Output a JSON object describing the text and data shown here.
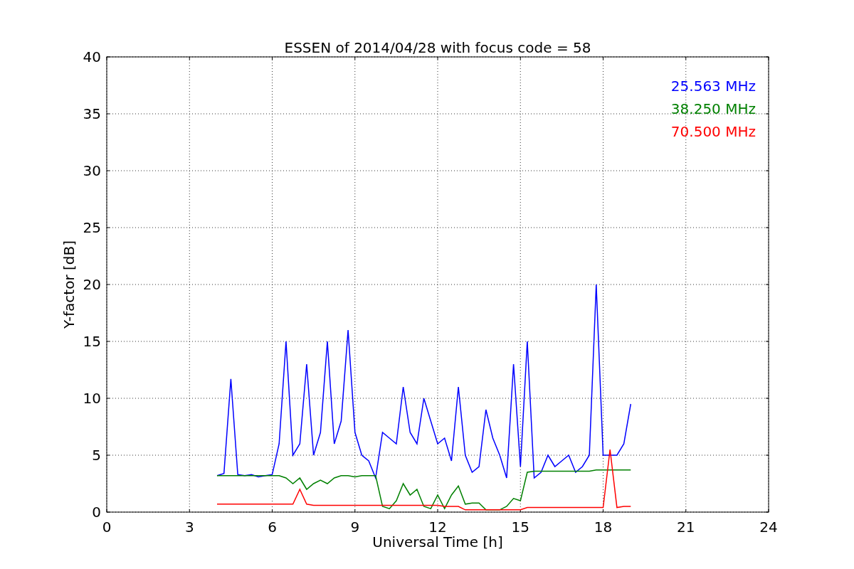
{
  "figure": {
    "chart_data": {
      "type": "line",
      "title": "ESSEN of 2014/04/28 with focus code = 58",
      "xlabel": "Universal Time [h]",
      "ylabel": "Y-factor [dB]",
      "grid": true,
      "xlim": [
        0,
        24
      ],
      "ylim": [
        0,
        40
      ],
      "xticks": [
        0,
        3,
        6,
        9,
        12,
        15,
        18,
        21,
        24
      ],
      "yticks": [
        0,
        5,
        10,
        15,
        20,
        25,
        30,
        35,
        40
      ],
      "x": [
        4,
        4.25,
        4.5,
        4.75,
        5,
        5.25,
        5.5,
        5.75,
        6,
        6.25,
        6.5,
        6.75,
        7,
        7.25,
        7.5,
        7.75,
        8,
        8.25,
        8.5,
        8.75,
        9,
        9.25,
        9.5,
        9.75,
        10,
        10.25,
        10.5,
        10.75,
        11,
        11.25,
        11.5,
        11.75,
        12,
        12.25,
        12.5,
        12.75,
        13,
        13.25,
        13.5,
        13.75,
        14,
        14.25,
        14.5,
        14.75,
        15,
        15.25,
        15.5,
        15.75,
        16,
        16.25,
        16.5,
        16.75,
        17,
        17.25,
        17.5,
        17.75,
        18,
        18.25,
        18.5,
        18.75,
        19
      ],
      "series": [
        {
          "name": "25.563 MHz",
          "color": "#0000ff",
          "values": [
            3.2,
            3.4,
            11.7,
            3.3,
            3.2,
            3.3,
            3.1,
            3.2,
            3.3,
            6,
            15,
            5,
            6,
            13,
            5,
            7,
            15,
            6,
            8,
            16,
            7,
            5,
            4.5,
            3,
            7,
            6.5,
            6,
            11,
            7,
            6,
            10,
            8,
            6,
            6.5,
            4.5,
            11,
            5,
            3.5,
            4,
            9,
            6.5,
            5,
            3,
            13,
            4,
            15,
            3,
            3.5,
            5,
            4,
            4.5,
            5,
            3.5,
            4,
            5,
            20,
            5,
            5,
            5,
            6,
            9.5
          ]
        },
        {
          "name": "38.250 MHz",
          "color": "#008000",
          "values": [
            3.2,
            3.2,
            3.2,
            3.2,
            3.2,
            3.2,
            3.2,
            3.2,
            3.2,
            3.2,
            3,
            2.5,
            3,
            2,
            2.5,
            2.8,
            2.5,
            3,
            3.2,
            3.2,
            3.1,
            3.2,
            3.2,
            3.2,
            0.5,
            0.3,
            1,
            2.5,
            1.5,
            2,
            0.5,
            0.3,
            1.5,
            0.3,
            1.5,
            2.3,
            0.7,
            0.8,
            0.8,
            0.2,
            0.2,
            0.2,
            0.5,
            1.2,
            1,
            3.5,
            3.6,
            3.6,
            3.6,
            3.6,
            3.6,
            3.6,
            3.6,
            3.6,
            3.6,
            3.7,
            3.7,
            3.7,
            3.7,
            3.7,
            3.7
          ]
        },
        {
          "name": "70.500 MHz",
          "color": "#ff0000",
          "values": [
            0.7,
            0.7,
            0.7,
            0.7,
            0.7,
            0.7,
            0.7,
            0.7,
            0.7,
            0.7,
            0.7,
            0.7,
            2,
            0.7,
            0.6,
            0.6,
            0.6,
            0.6,
            0.6,
            0.6,
            0.6,
            0.6,
            0.6,
            0.6,
            0.6,
            0.6,
            0.6,
            0.6,
            0.6,
            0.6,
            0.6,
            0.6,
            0.6,
            0.5,
            0.5,
            0.5,
            0.2,
            0.2,
            0.2,
            0.2,
            0.2,
            0.2,
            0.2,
            0.2,
            0.2,
            0.4,
            0.4,
            0.4,
            0.4,
            0.4,
            0.4,
            0.4,
            0.4,
            0.4,
            0.4,
            0.4,
            0.4,
            5.5,
            0.4,
            0.5,
            0.5
          ]
        }
      ]
    }
  }
}
